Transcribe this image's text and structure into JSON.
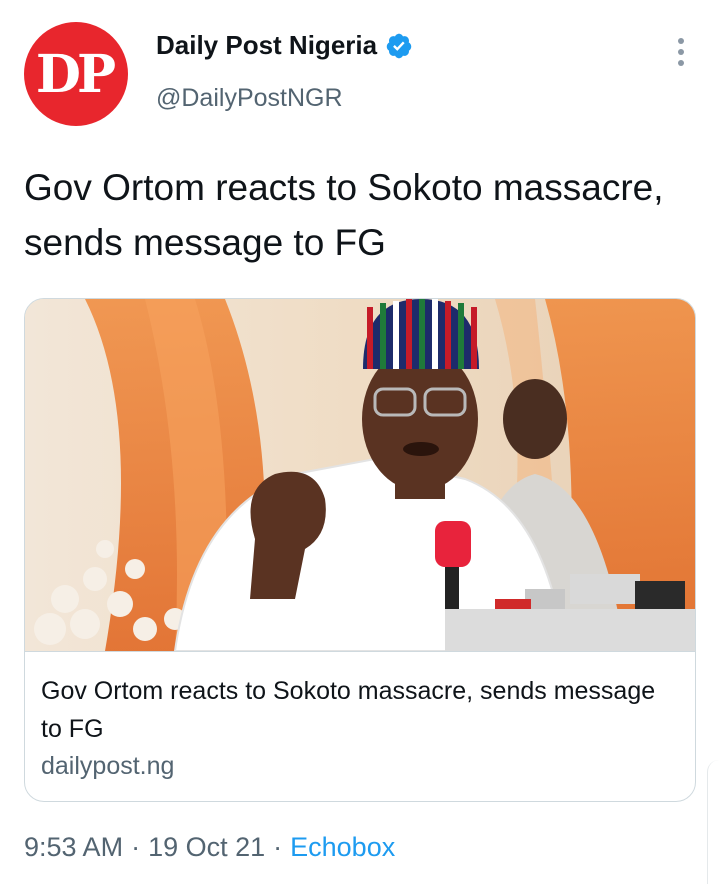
{
  "profile": {
    "avatar_text": "DP",
    "display_name": "Daily Post Nigeria",
    "handle": "@DailyPostNGR",
    "verified_icon": "verified-badge-icon"
  },
  "tweet": {
    "text": "Gov Ortom reacts to Sokoto massacre, sends message to FG"
  },
  "card": {
    "image_alt": "Photo of Governor Ortom speaking at a microphone",
    "title": "Gov Ortom reacts to Sokoto massacre, sends message to FG",
    "domain": "dailypost.ng"
  },
  "meta": {
    "time": "9:53 AM",
    "separator": "·",
    "date": "19 Oct 21",
    "source": "Echobox"
  },
  "colors": {
    "avatar_bg": "#e8262d",
    "link": "#1d9bf0",
    "secondary_text": "#536471",
    "verified": "#1d9bf0"
  }
}
